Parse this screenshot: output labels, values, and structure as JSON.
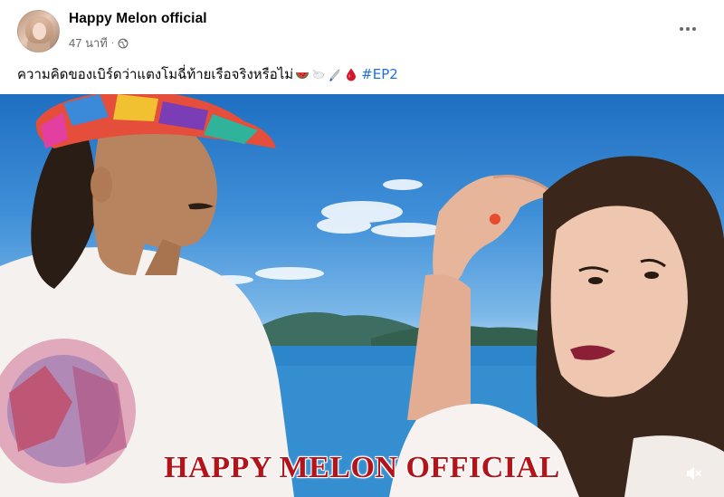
{
  "post": {
    "page_name": "Happy Melon official",
    "time_ago": "47 นาที",
    "separator": "·",
    "caption_text": "ความคิดของเบิร์ดว่าแตงโมฉี่ท้ายเรือจริงหรือไม่",
    "hashtag": "#EP2",
    "caption_emojis": [
      "watermelon-emoji",
      "dove-emoji",
      "knife-emoji",
      "blood-drop-emoji"
    ]
  },
  "media": {
    "watermark_text": "HAPPY MELON OFFICIAL"
  },
  "colors": {
    "link": "#216fdb",
    "secondary_text": "#65676b",
    "watermark": "#b3141a"
  }
}
